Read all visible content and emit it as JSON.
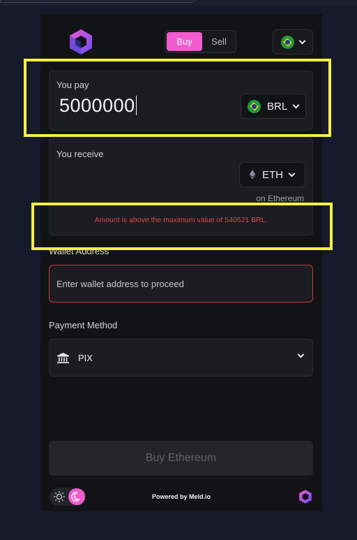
{
  "header": {
    "tabs": {
      "buy_label": "Buy",
      "sell_label": "Sell",
      "active": "Buy"
    },
    "country_icon": "brazil-flag-icon"
  },
  "pay": {
    "label": "You pay",
    "amount": "5000000",
    "currency": "BRL",
    "currency_icon": "brazil-flag-icon"
  },
  "receive": {
    "label": "You receive",
    "currency": "ETH",
    "currency_icon": "ethereum-icon",
    "network": "on Ethereum",
    "error": "Amount is above the maximum value of 540521 BRL."
  },
  "wallet": {
    "label": "Wallet Address",
    "placeholder": "Enter wallet address to proceed"
  },
  "payment": {
    "label": "Payment Method",
    "value": "PIX",
    "icon": "bank-icon"
  },
  "submit": {
    "label": "Buy Ethereum"
  },
  "footer": {
    "powered_by": "Powered by Meld.io",
    "theme": "dark"
  },
  "colors": {
    "accent": "#f25ccf",
    "error": "#e0454c",
    "highlight": "#f5f23c",
    "page_background": "#171a2b",
    "widget_background": "#121316"
  }
}
